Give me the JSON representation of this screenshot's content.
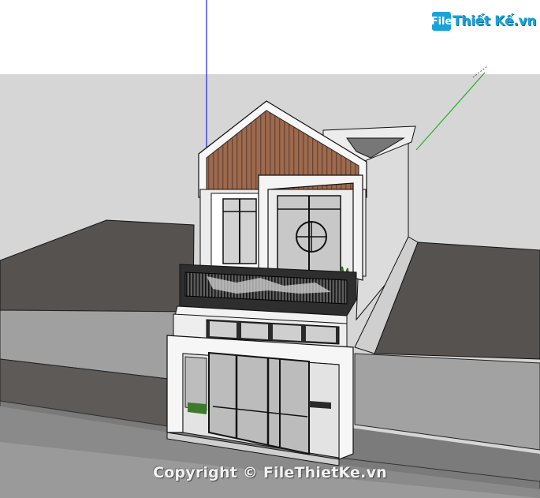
{
  "logo": {
    "icon_text": "File",
    "text": "Thiết Kế.vn"
  },
  "watermark": "Copyright © FileThietKe.vn",
  "colors": {
    "sky": "#ffffff",
    "horizon_ground": "#d6d6d6",
    "terrain": "#565250",
    "wall": "#9a9a9a",
    "street": "#7a7a7a",
    "wood": "#9c6a4e",
    "axis_blue": "#2020e0",
    "axis_green": "#22b022",
    "logo_blue": "#1aa3d9"
  }
}
